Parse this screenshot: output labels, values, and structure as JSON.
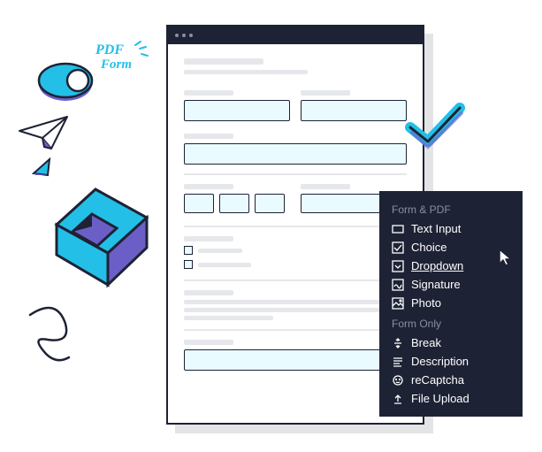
{
  "badge": {
    "line1": "PDF",
    "line2": "Form"
  },
  "menu": {
    "section1": "Form & PDF",
    "section2": "Form Only",
    "items_pdf": [
      {
        "label": "Text Input",
        "icon": "text-input-icon"
      },
      {
        "label": "Choice",
        "icon": "choice-icon"
      },
      {
        "label": "Dropdown",
        "icon": "dropdown-icon",
        "hover": true
      },
      {
        "label": "Signature",
        "icon": "signature-icon"
      },
      {
        "label": "Photo",
        "icon": "photo-icon"
      }
    ],
    "items_form": [
      {
        "label": "Break",
        "icon": "break-icon"
      },
      {
        "label": "Description",
        "icon": "description-icon"
      },
      {
        "label": "reCaptcha",
        "icon": "recaptcha-icon"
      },
      {
        "label": "File Upload",
        "icon": "upload-icon"
      }
    ]
  }
}
